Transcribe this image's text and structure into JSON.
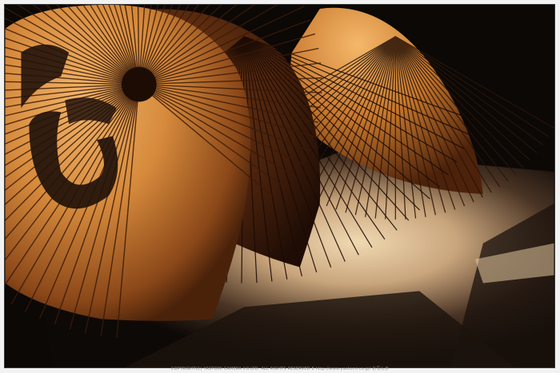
{
  "photo": {
    "subject": "wagasa-umbrellas",
    "palette": {
      "background": "#0a0705",
      "ground_light": "#e8cfa6",
      "ground_dark": "#3a2a1c",
      "paper_glow": "#e8a65a",
      "paper_mid": "#b86d2c",
      "paper_dark": "#5a2d10",
      "rib": "#2a1508",
      "calligraphy": "#22120a"
    }
  },
  "footer": {
    "copyright_text": "COPYRIGHT(C) YASTOMI CAMERA CO.LTD. ALL RIGHTS RESERVED E http://www.yastomi.co.jp/ お写ん歩"
  }
}
